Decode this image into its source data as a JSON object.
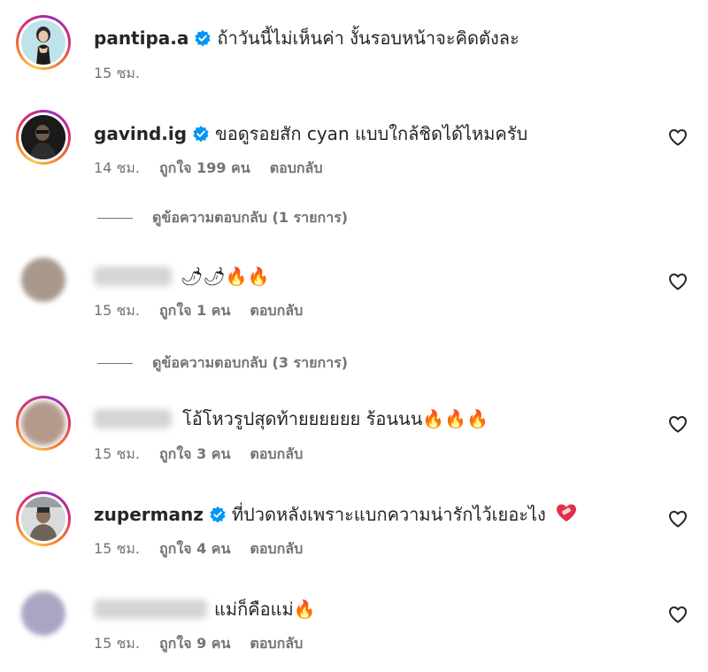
{
  "comments": [
    {
      "username": "pantipa.a",
      "verified": true,
      "text": "ถ้าวันนี้ไม่เห็นค่า งั้นรอบหน้าจะคิดตังละ",
      "time": "15 ชม.",
      "likes": "",
      "reply_label": "",
      "avatar": "woman-photo"
    },
    {
      "username": "gavind.ig",
      "verified": true,
      "text": "ขอดูรอยสัก cyan แบบใกล้ชิดได้ไหมครับ",
      "time": "14 ชม.",
      "likes": "ถูกใจ 199 คน",
      "reply_label": "ตอบกลับ",
      "view_replies": "ดูข้อความตอบกลับ (1 รายการ)",
      "avatar": "man-photo"
    },
    {
      "username": "",
      "verified": false,
      "text": "",
      "emojis": "🌶🌶🔥🔥",
      "time": "15 ชม.",
      "likes": "ถูกใจ 1 คน",
      "reply_label": "ตอบกลับ",
      "view_replies": "ดูข้อความตอบกลับ (3 รายการ)",
      "avatar": "blurred"
    },
    {
      "username": "",
      "verified": false,
      "text": "โอ้โหวรูปสุดท้ายยยยยย ร้อนนน",
      "emojis": "🔥🔥🔥",
      "time": "15 ชม.",
      "likes": "ถูกใจ 3 คน",
      "reply_label": "ตอบกลับ",
      "avatar": "blurred"
    },
    {
      "username": "zupermanz",
      "verified": true,
      "text": "ที่ปวดหลังเพราะแบกความน่ารักไว้เยอะไง",
      "emojis": "❤️‍🩹",
      "time": "15 ชม.",
      "likes": "ถูกใจ 4 คน",
      "reply_label": "ตอบกลับ",
      "avatar": "man-photo-2"
    },
    {
      "username": "",
      "verified": false,
      "text": "แม่ก็คือแม่",
      "emojis": "🔥",
      "time": "15 ชม.",
      "likes": "ถูกใจ 9 คน",
      "reply_label": "ตอบกลับ",
      "avatar": "blurred"
    }
  ],
  "colors": {
    "verified": "#0095f6",
    "meta": "#737373",
    "text": "#262626"
  }
}
